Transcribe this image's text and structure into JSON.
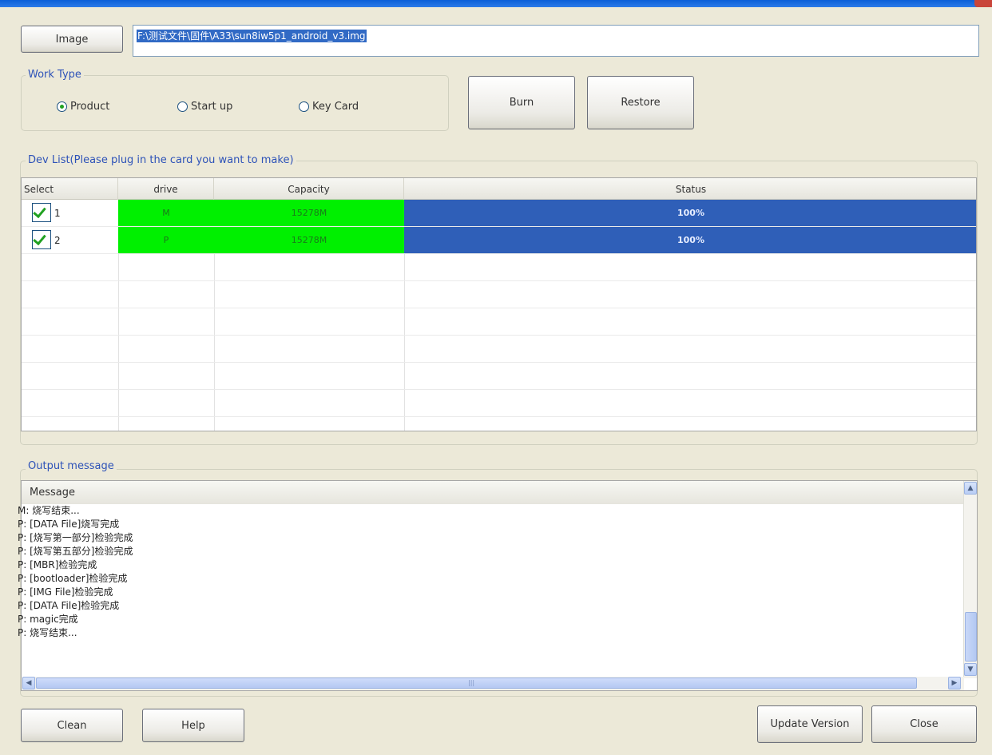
{
  "window": {
    "accent": "#0a5fd8",
    "background": "#ece9d8"
  },
  "image_button": "Image",
  "image_path": "F:\\测试文件\\固件\\A33\\sun8iw5p1_android_v3.img",
  "work_type": {
    "legend": "Work Type",
    "options": [
      {
        "label": "Product",
        "selected": true
      },
      {
        "label": "Start up",
        "selected": false
      },
      {
        "label": "Key Card",
        "selected": false
      }
    ]
  },
  "actions": {
    "burn": "Burn",
    "restore": "Restore"
  },
  "dev_list": {
    "legend": "Dev List(Please plug in the card you want to make)",
    "columns": [
      "Select",
      "drive",
      "Capacity",
      "Status"
    ],
    "rows": [
      {
        "index": "1",
        "checked": true,
        "drive": "M",
        "capacity": "15278M",
        "status": "100%"
      },
      {
        "index": "2",
        "checked": true,
        "drive": "P",
        "capacity": "15278M",
        "status": "100%"
      }
    ],
    "colors": {
      "drive_bg": "#00f000",
      "status_bg": "#2f5fb8"
    }
  },
  "output": {
    "legend": "Output message",
    "header": "Message",
    "lines": [
      "M: 烧写结束...",
      "P: [DATA File]烧写完成",
      "P: [烧写第一部分]检验完成",
      "P: [烧写第五部分]检验完成",
      "P: [MBR]检验完成",
      "P: [bootloader]检验完成",
      "P: [IMG File]检验完成",
      "P: [DATA File]检验完成",
      "P: magic完成",
      "P: 烧写结束..."
    ],
    "hscroll_grip": "|||"
  },
  "footer": {
    "clean": "Clean",
    "help": "Help",
    "update_version": "Update Version",
    "close": "Close"
  }
}
